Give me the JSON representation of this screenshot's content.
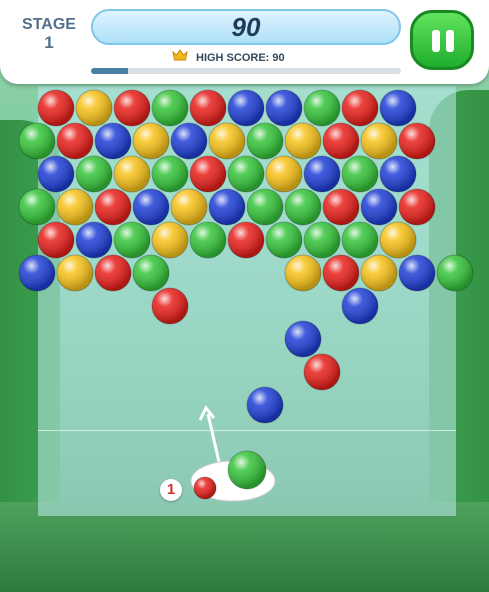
{
  "hud": {
    "stage_label": "STAGE",
    "stage_number": "1",
    "score": "90",
    "high_score_label": "HIGH SCORE: 90",
    "progress": 0.12,
    "pause_icon": "pause-icon",
    "crown_icon": "crown-icon"
  },
  "launcher": {
    "shots_remaining": "1",
    "current_bubble": "green",
    "next_bubble": "red"
  },
  "colors": {
    "red": "#e8201b",
    "yellow": "#f7c21a",
    "green": "#35c43a",
    "blue": "#1f3fd6",
    "accent": "#3fcf3f"
  },
  "bubble_rows": [
    [
      "red",
      "yellow",
      "red",
      "green",
      "red",
      "blue",
      "blue",
      "green",
      "red",
      "blue"
    ],
    [
      "green",
      "red",
      "blue",
      "yellow",
      "blue",
      "yellow",
      "green",
      "yellow",
      "red",
      "yellow",
      "red"
    ],
    [
      "blue",
      "green",
      "yellow",
      "green",
      "red",
      "green",
      "yellow",
      "blue",
      "green",
      "blue"
    ],
    [
      "green",
      "yellow",
      "red",
      "blue",
      "yellow",
      "blue",
      "green",
      "green",
      "red",
      "blue",
      "red"
    ],
    [
      "red",
      "blue",
      "green",
      "yellow",
      "green",
      "red",
      "green",
      "green",
      "green",
      "yellow"
    ],
    [
      "blue",
      "yellow",
      "red",
      "green",
      "",
      "",
      "",
      "yellow",
      "red",
      "yellow",
      "blue",
      "green"
    ],
    [
      "",
      "",
      "",
      "red",
      "",
      "",
      "",
      "",
      "blue"
    ],
    [
      "",
      "",
      "",
      "",
      "",
      "",
      "",
      "blue"
    ],
    [
      "",
      "",
      "",
      "",
      "",
      "",
      "",
      "red"
    ],
    [
      "",
      "",
      "",
      "",
      "",
      "",
      "blue"
    ]
  ]
}
